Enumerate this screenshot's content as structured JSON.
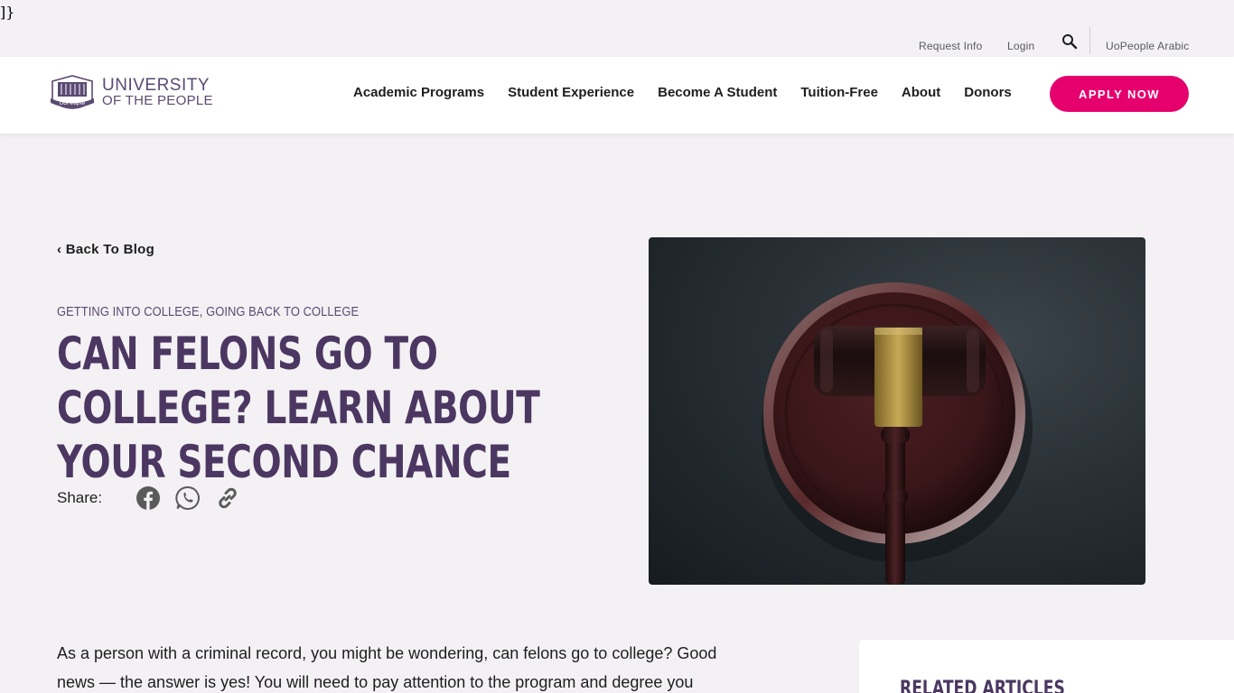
{
  "stray_text": "]}",
  "utility": {
    "request_info": "Request Info",
    "login": "Login",
    "arabic": "UoPeople Arabic"
  },
  "logo": {
    "line1": "UNIVERSITY",
    "line2": "OF THE PEOPLE",
    "badge": "UoPeople"
  },
  "nav": {
    "items": [
      {
        "label": "Academic Programs"
      },
      {
        "label": "Student Experience"
      },
      {
        "label": "Become A Student"
      },
      {
        "label": "Tuition-Free"
      },
      {
        "label": "About"
      },
      {
        "label": "Donors"
      }
    ],
    "apply": "APPLY NOW"
  },
  "article": {
    "back": "‹ Back To Blog",
    "categories": "Getting into College, Going back to College",
    "title": "Can Felons Go to College? Learn About Your Second Chance",
    "share_label": "Share:",
    "intro": "As a person with a criminal record, you might be wondering, can felons go to college? Good news — the answer is yes! You will need to pay attention to the program and degree you"
  },
  "sidebar": {
    "related_title": "Related Articles"
  },
  "colors": {
    "accent": "#e6006e",
    "brand_purple": "#4b3761",
    "background": "#f3f1f4"
  },
  "icons": [
    "search-icon",
    "facebook-icon",
    "whatsapp-icon",
    "link-icon",
    "gavel-image"
  ]
}
